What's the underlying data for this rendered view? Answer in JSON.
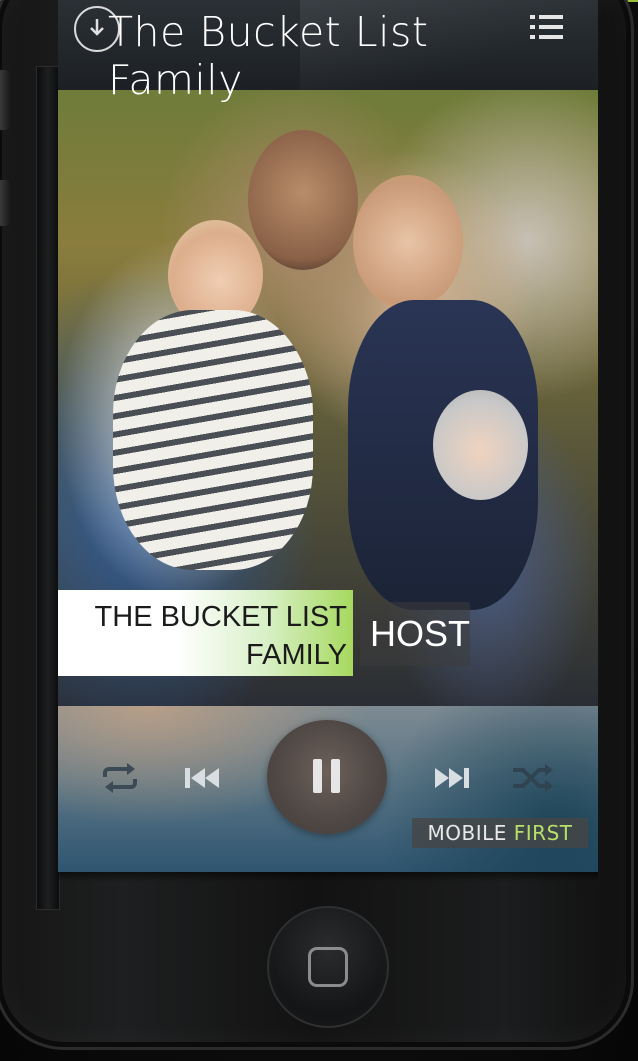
{
  "header": {
    "title": "The Bucket List Family",
    "download_icon": "download-circle-icon",
    "menu_icon": "list-menu-icon"
  },
  "media": {
    "photo_subject": "",
    "show_label": "THE BUCKET LIST FAMILY",
    "role_label": "HOST"
  },
  "player": {
    "controls": [
      "repeat-icon",
      "previous-icon",
      "pause-icon",
      "next-icon",
      "shuffle-icon"
    ],
    "state": "playing"
  },
  "brand": {
    "word1": "MOBILE",
    "word2": "FIRST"
  },
  "colors": {
    "accent": "#a6d95f",
    "title_bar": "#2b3035",
    "brand_green": "#b7e06a"
  }
}
